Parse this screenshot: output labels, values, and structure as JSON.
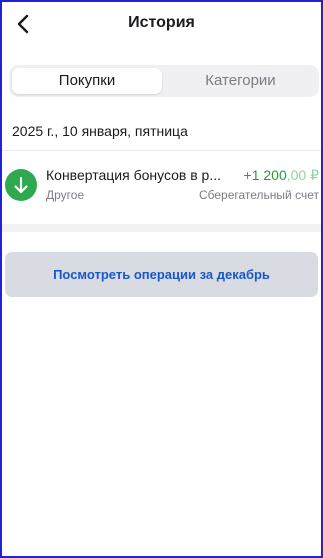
{
  "header": {
    "title": "История",
    "back_icon": "chevron-left-icon"
  },
  "tabs": [
    {
      "label": "Покупки",
      "active": true
    },
    {
      "label": "Категории",
      "active": false
    }
  ],
  "date_heading": "2025 г., 10 января, пятница",
  "transactions": [
    {
      "icon": "arrow-down-icon",
      "icon_color": "#2ea94f",
      "title": "Конвертация бонусов в р...",
      "amount_main": "+1 200",
      "amount_fraction": ",00 ₽",
      "amount_color": "#21a038",
      "category": "Другое",
      "account": "Сберегательный счет"
    }
  ],
  "more_button": {
    "label": "Посмотреть операции за декабрь"
  },
  "colors": {
    "frame_border": "#1f22d6",
    "accent_link": "#1a58c8"
  }
}
